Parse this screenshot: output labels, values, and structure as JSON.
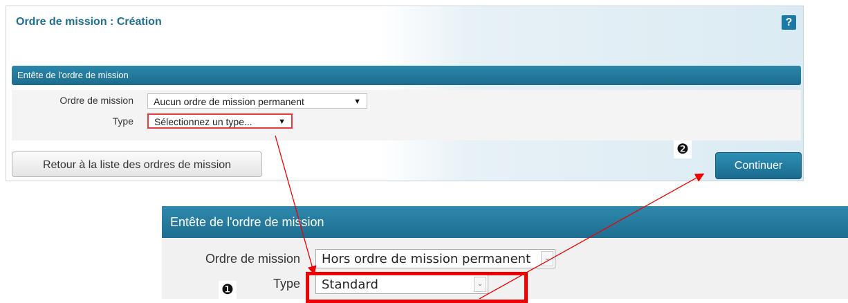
{
  "top": {
    "title": "Ordre de mission : Création",
    "help_icon": "?",
    "section_title": "Entête de l'ordre de mission",
    "fields": {
      "ordre_label": "Ordre de mission",
      "ordre_value": "Aucun ordre de mission permanent",
      "type_label": "Type",
      "type_value": "Sélectionnez un type..."
    },
    "back_button": "Retour à la liste des ordres de mission",
    "continue_button": "Continuer",
    "step2_marker": "❷"
  },
  "zoom": {
    "section_title": "Entête de l'ordre de mission",
    "ordre_label": "Ordre de mission",
    "ordre_value": "Hors ordre de mission permanent",
    "type_label": "Type",
    "type_value": "Standard",
    "step1_marker": "❶"
  },
  "icons": {
    "help": "help-icon",
    "dropdown": "chevron-down-icon",
    "arrow": "▼"
  },
  "colors": {
    "accent": "#1e6f92",
    "header_bar": "#2b87aa",
    "error": "#e63b3b",
    "annotation": "#ee0000"
  }
}
